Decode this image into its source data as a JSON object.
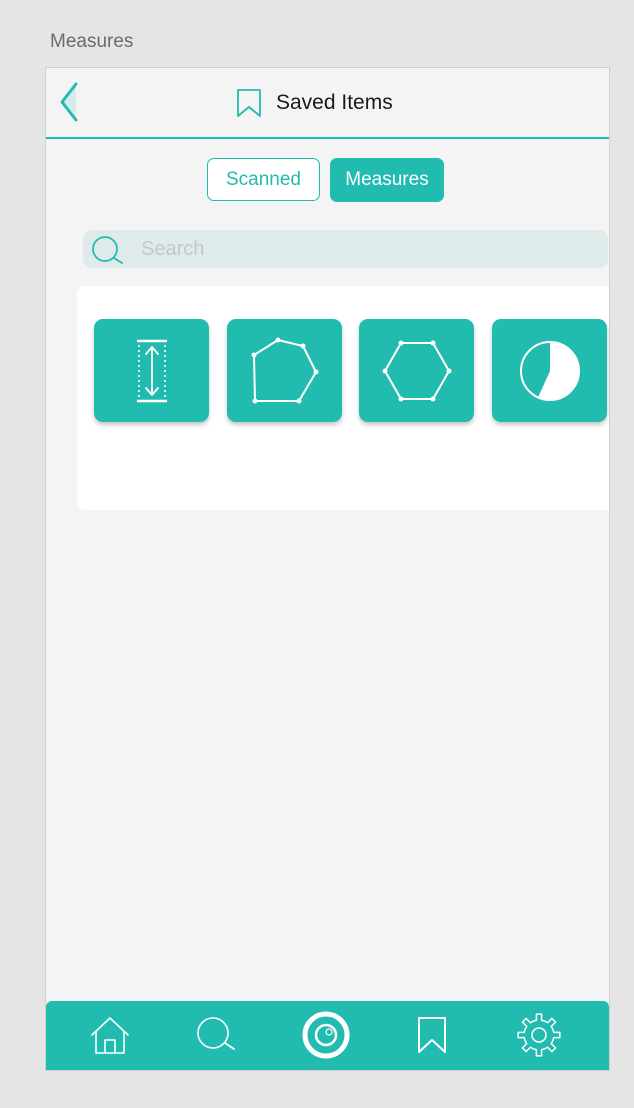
{
  "artboard": {
    "label": "Measures"
  },
  "header": {
    "title": "Saved Items",
    "back_icon": "chevron-left-icon",
    "title_icon": "bookmark-icon"
  },
  "segments": {
    "scanned_label": "Scanned",
    "measures_label": "Measures",
    "selected": "Measures"
  },
  "search": {
    "placeholder": "Search",
    "value": "",
    "icon": "search-icon"
  },
  "measure_items": [
    {
      "icon": "height-measure-icon"
    },
    {
      "icon": "heptagon-measure-icon"
    },
    {
      "icon": "hexagon-measure-icon"
    },
    {
      "icon": "pie-measure-icon"
    }
  ],
  "bottom_nav": {
    "items": [
      {
        "icon": "home-icon"
      },
      {
        "icon": "search-icon"
      },
      {
        "icon": "camera-icon"
      },
      {
        "icon": "bookmark-icon"
      },
      {
        "icon": "gear-icon"
      }
    ]
  },
  "colors": {
    "accent": "#22bbb0",
    "background": "#f4f4f4",
    "page_background": "#e5e5e5",
    "search_background": "#dfeaea"
  }
}
